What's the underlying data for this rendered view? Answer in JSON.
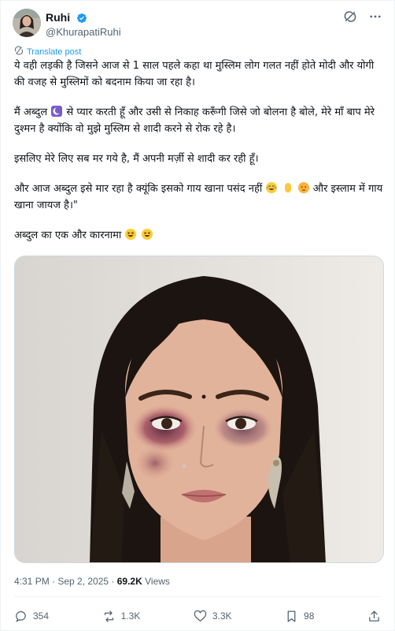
{
  "author": {
    "name": "Ruhi",
    "handle": "@KhurapatiRuhi",
    "verified": true,
    "verified_color": "#1d9bf0",
    "avatar_icon": "profile-photo"
  },
  "header_icons": [
    "grok-icon",
    "more-icon"
  ],
  "translate_label": "Translate post",
  "post": {
    "p1": "ये वही लड़की है जिसने आज से 1 साल पहले कहा था मुस्लिम लोग गलत नहीं होते मोदी और योगी की वजह से मुस्लिमों को बदनाम किया जा रहा है।",
    "p2_a": "मैं अब्दुल",
    "p2_b": "से प्यार करती हूँ और उसी से निकाह करूँगी जिसे जो बोलना है बोले, मेरे माँ बाप मेरे दुश्मन है क्योंकि वो मुझे मुस्लिम से शादी करने से रोक रहे है।",
    "p3": "इसलिए मेरे लिए सब मर गये है, मैं अपनी मर्ज़ी से शादी कर रही हूँ।",
    "p4_a": "और आज अब्दुल इसे मार रहा है क्यूंकि इसको गाय खाना पसंद नहीं",
    "p4_b": "और इस्लाम में गाय खाना जायज है।\"",
    "p5": "अब्दुल का एक और कारनामा"
  },
  "emojis": [
    "crescent-moon-emoji",
    "joy-emoji",
    "raised-hand-emoji",
    "face-emoji",
    "grinning-emoji"
  ],
  "media": {
    "description_icon": "photo-of-woman-with-bruised-eyes"
  },
  "timestamp": "4:31 PM · Sep 2, 2025 · ",
  "views_count": "69.2K",
  "views_label": " Views",
  "actions": {
    "replies": "354",
    "reposts": "1.3K",
    "likes": "3.3K",
    "bookmarks": "98"
  },
  "colors": {
    "accent": "#1d9bf0",
    "text": "#0f1419",
    "muted": "#536471"
  }
}
